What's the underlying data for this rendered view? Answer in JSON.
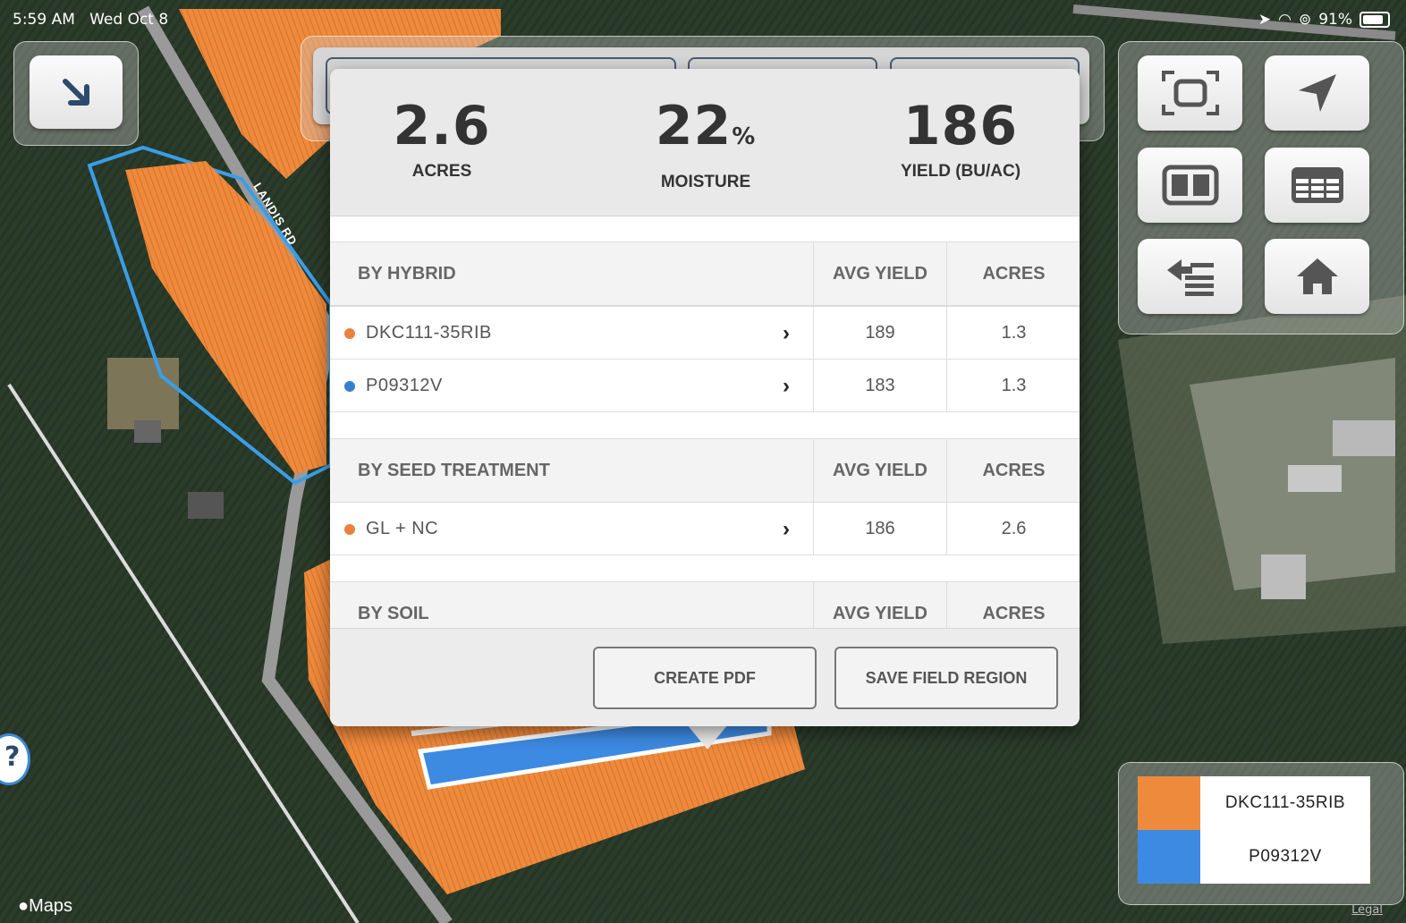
{
  "status_bar": {
    "time": "5:59 AM",
    "date": "Wed Oct 8",
    "battery": "91%"
  },
  "map": {
    "road_label": "LANDIS RD",
    "maps_label": "Maps",
    "legal_label": "Legal"
  },
  "summary": {
    "acres": {
      "value": "2.6",
      "label": "ACRES"
    },
    "moisture": {
      "value": "22",
      "unit": "%",
      "label": "MOISTURE"
    },
    "yield": {
      "value": "186",
      "label": "YIELD (BU/AC)"
    }
  },
  "sections": [
    {
      "title": "BY HYBRID",
      "avg_label": "AVG YIELD",
      "acres_label": "ACRES",
      "rows": [
        {
          "name": "DKC111-35RIB",
          "avg": "189",
          "acres": "1.3",
          "color": "#e8823e"
        },
        {
          "name": "P09312V",
          "avg": "183",
          "acres": "1.3",
          "color": "#3a7fcf"
        }
      ]
    },
    {
      "title": "BY SEED TREATMENT",
      "avg_label": "AVG YIELD",
      "acres_label": "ACRES",
      "rows": [
        {
          "name": "GL + NC",
          "avg": "186",
          "acres": "2.6",
          "color": "#e8823e"
        }
      ]
    },
    {
      "title": "BY SOIL",
      "avg_label": "AVG YIELD",
      "acres_label": "ACRES",
      "rows": []
    }
  ],
  "buttons": {
    "create_pdf": "CREATE PDF",
    "save_region": "SAVE FIELD REGION"
  },
  "toolbar_icons": [
    "collapse-arrow-icon",
    "focus-frame-icon",
    "location-arrow-icon",
    "split-view-icon",
    "table-icon",
    "import-list-icon",
    "home-icon"
  ],
  "legend": [
    {
      "label": "DKC111-35RIB",
      "color": "#ee8a3c"
    },
    {
      "label": "P09312V",
      "color": "#3d8ae3"
    }
  ]
}
